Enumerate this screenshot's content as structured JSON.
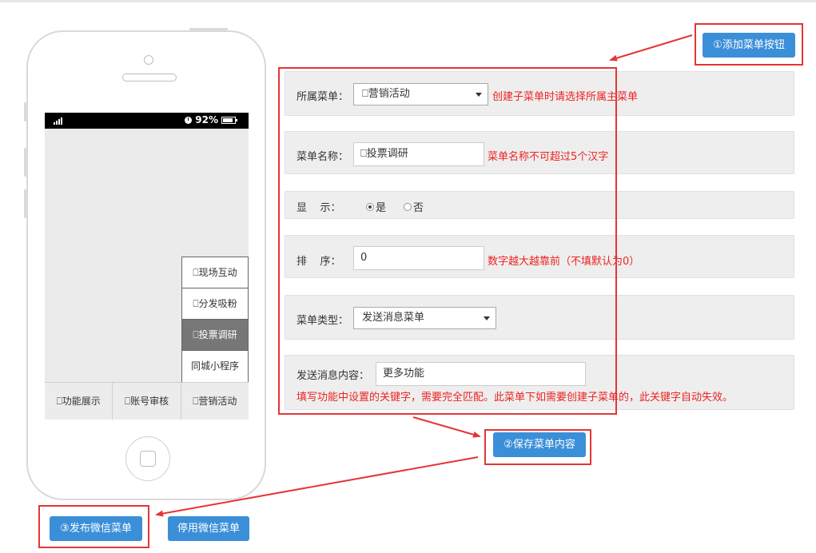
{
  "phone": {
    "status": {
      "battery": "92%"
    },
    "submenu": [
      {
        "label": "⎕现场互动",
        "active": false
      },
      {
        "label": "⎕分发吸粉",
        "active": false
      },
      {
        "label": "⎕投票调研",
        "active": true
      },
      {
        "label": "同城小程序",
        "active": false
      }
    ],
    "menubar": [
      {
        "label": "⎕功能展示"
      },
      {
        "label": "⎕账号审核"
      },
      {
        "label": "⎕营销活动"
      }
    ]
  },
  "form": {
    "parent_menu": {
      "label": "所属菜单：",
      "value": "⎕营销活动",
      "hint": "创建子菜单时请选择所属主菜单"
    },
    "menu_name": {
      "label": "菜单名称：",
      "value": "⎕投票调研",
      "hint": "菜单名称不可超过5个汉字"
    },
    "display": {
      "label": "显    示：",
      "option_yes": "是",
      "option_no": "否",
      "selected": "是"
    },
    "sort": {
      "label": "排    序：",
      "value": "0",
      "hint": "数字越大越靠前（不填默认为0）"
    },
    "menu_type": {
      "label": "菜单类型：",
      "value": "发送消息菜单"
    },
    "message_content": {
      "label": "发送消息内容：",
      "value": "更多功能",
      "hint": "填写功能中设置的关键字，需要完全匹配。此菜单下如需要创建子菜单的，此关键字自动失效。"
    }
  },
  "buttons": {
    "add_menu": "①添加菜单按钮",
    "save_menu": "②保存菜单内容",
    "publish_menu": "③发布微信菜单",
    "disable_menu": "停用微信菜单"
  },
  "colors": {
    "button_blue": "#3b8fd8",
    "annotation_red": "#e53535",
    "hint_red": "#ee2222"
  }
}
